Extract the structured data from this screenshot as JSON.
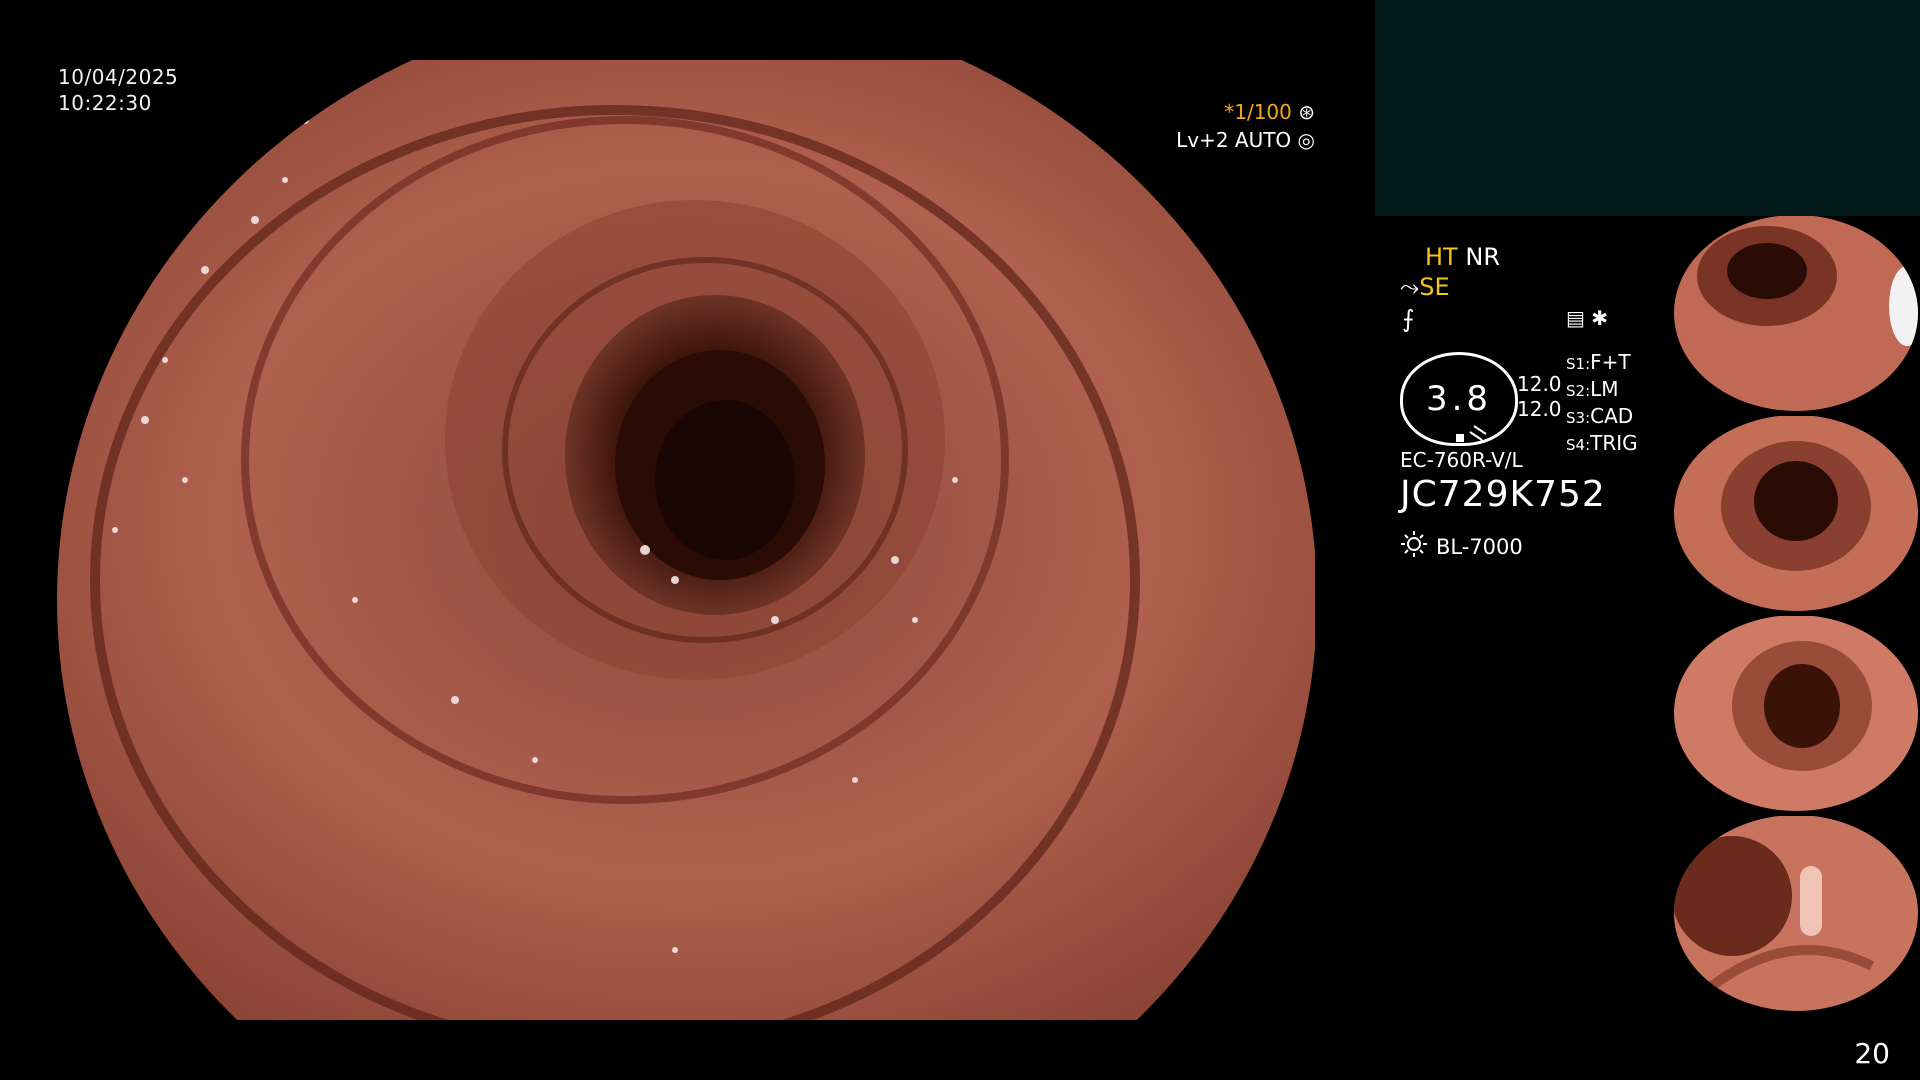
{
  "overlay": {
    "date": "10/04/2025",
    "time": "10:22:30",
    "shutter": "*1/100",
    "level": "Lv+2 AUTO"
  },
  "status": {
    "ht": "HT",
    "nr": "NR",
    "se": "SE",
    "zoom": "3.8",
    "val1": "12.0",
    "val2": "12.0",
    "s1": {
      "key": "S1:",
      "value": "F+T"
    },
    "s2": {
      "key": "S2:",
      "value": "LM"
    },
    "s3": {
      "key": "S3:",
      "value": "CAD"
    },
    "s4": {
      "key": "S4:",
      "value": "TRIG"
    },
    "model": "EC-760R-V/L",
    "serial": "JC729K752",
    "light_source": "BL-7000"
  },
  "thumbnails": [
    "captured-image-1",
    "captured-image-2",
    "captured-image-3",
    "captured-image-4"
  ],
  "page_number": "20",
  "colors": {
    "accent_orange": "#f5a623",
    "accent_yellow": "#f5c518",
    "panel_teal": "#031a1a"
  }
}
